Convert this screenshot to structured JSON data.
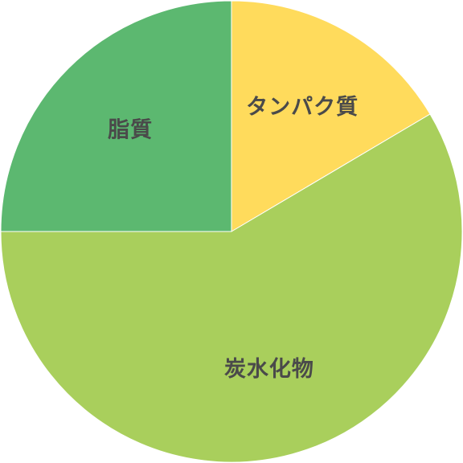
{
  "chart_data": {
    "type": "pie",
    "title": "",
    "labels": [
      "タンパク質",
      "炭水化物",
      "脂質"
    ],
    "values": [
      16.5,
      58.5,
      25.0
    ],
    "colors": [
      "#ffdb5c",
      "#a9cf5c",
      "#5cb870"
    ],
    "start_angle_deg": 0,
    "direction": "clockwise",
    "legend": "none"
  }
}
